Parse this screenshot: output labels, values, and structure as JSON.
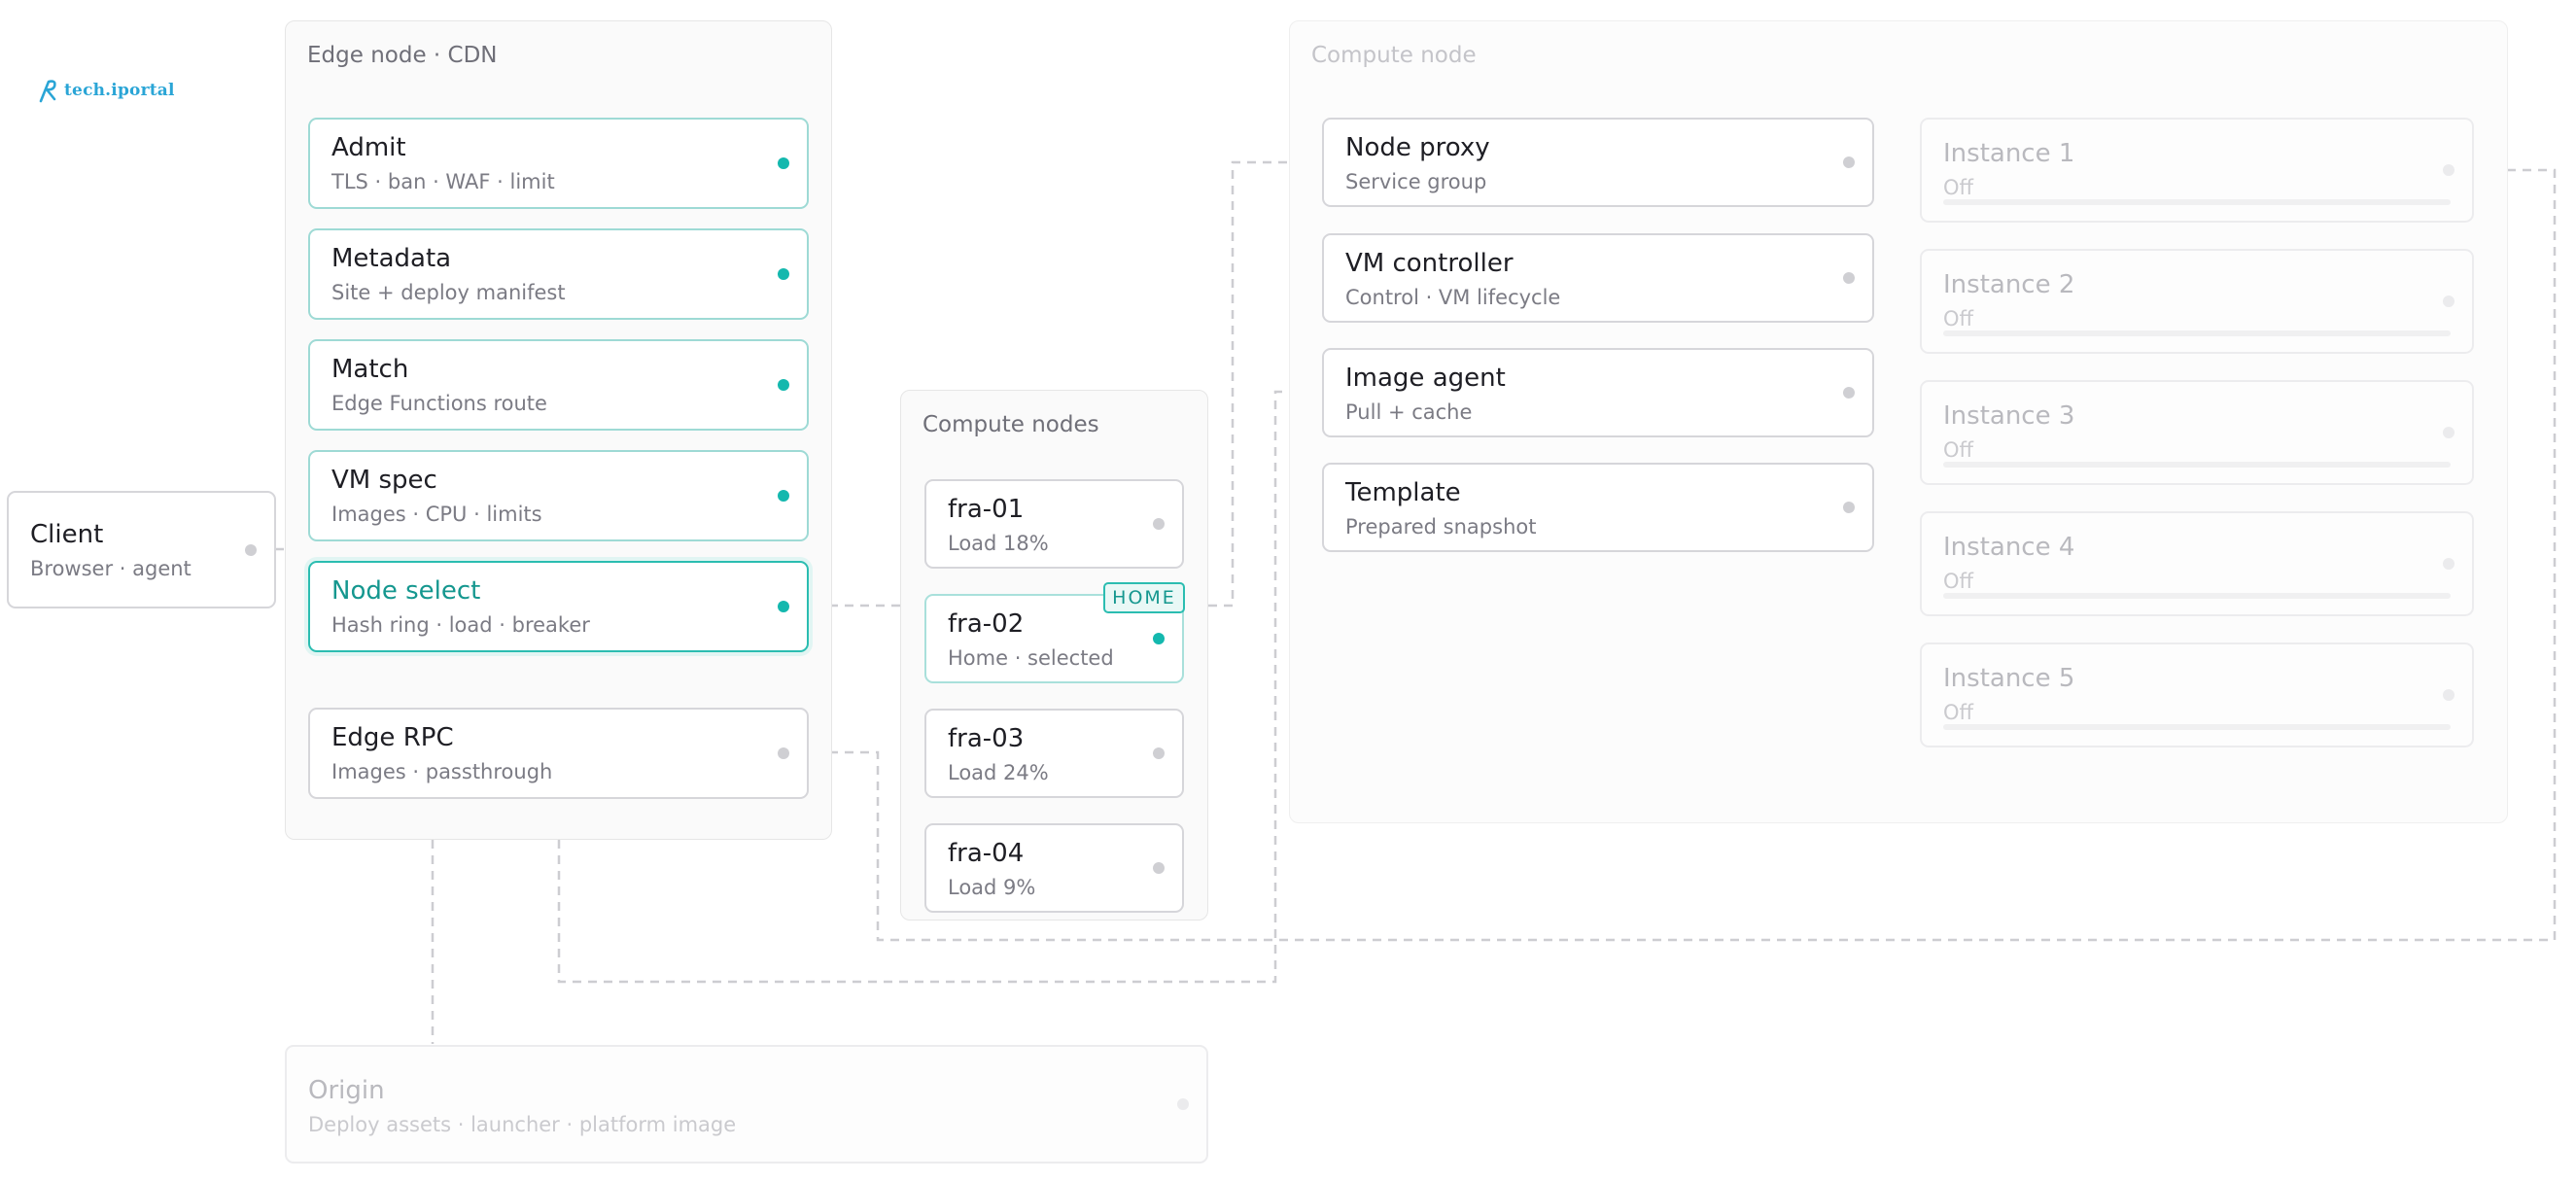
{
  "logo": {
    "text": "tech.iportal"
  },
  "client": {
    "title": "Client",
    "subtitle": "Browser · agent"
  },
  "edge": {
    "title": "Edge node · CDN",
    "stages": [
      {
        "title": "Admit",
        "subtitle": "TLS · ban · WAF · limit"
      },
      {
        "title": "Metadata",
        "subtitle": "Site + deploy manifest"
      },
      {
        "title": "Match",
        "subtitle": "Edge Functions route"
      },
      {
        "title": "VM spec",
        "subtitle": "Images · CPU · limits"
      },
      {
        "title": "Node select",
        "subtitle": "Hash ring · load · breaker"
      }
    ],
    "rpc": {
      "title": "Edge RPC",
      "subtitle": "Images · passthrough"
    }
  },
  "compute_nodes": {
    "title": "Compute nodes",
    "home_badge": "HOME",
    "nodes": [
      {
        "title": "fra-01",
        "subtitle": "Load 18%"
      },
      {
        "title": "fra-02",
        "subtitle": "Home · selected"
      },
      {
        "title": "fra-03",
        "subtitle": "Load 24%"
      },
      {
        "title": "fra-04",
        "subtitle": "Load 9%"
      }
    ]
  },
  "compute_node": {
    "title": "Compute node",
    "services": [
      {
        "title": "Node proxy",
        "subtitle": "Service group"
      },
      {
        "title": "VM controller",
        "subtitle": "Control · VM lifecycle"
      },
      {
        "title": "Image agent",
        "subtitle": "Pull + cache"
      },
      {
        "title": "Template",
        "subtitle": "Prepared snapshot"
      }
    ],
    "instances": [
      {
        "title": "Instance 1",
        "status": "Off"
      },
      {
        "title": "Instance 2",
        "status": "Off"
      },
      {
        "title": "Instance 3",
        "status": "Off"
      },
      {
        "title": "Instance 4",
        "status": "Off"
      },
      {
        "title": "Instance 5",
        "status": "Off"
      }
    ]
  },
  "origin": {
    "title": "Origin",
    "subtitle": "Deploy assets · launcher · platform image"
  },
  "colors": {
    "accent": "#14b8ae",
    "logo": "#2aa5d6",
    "inactive": "#cfcfd3"
  }
}
